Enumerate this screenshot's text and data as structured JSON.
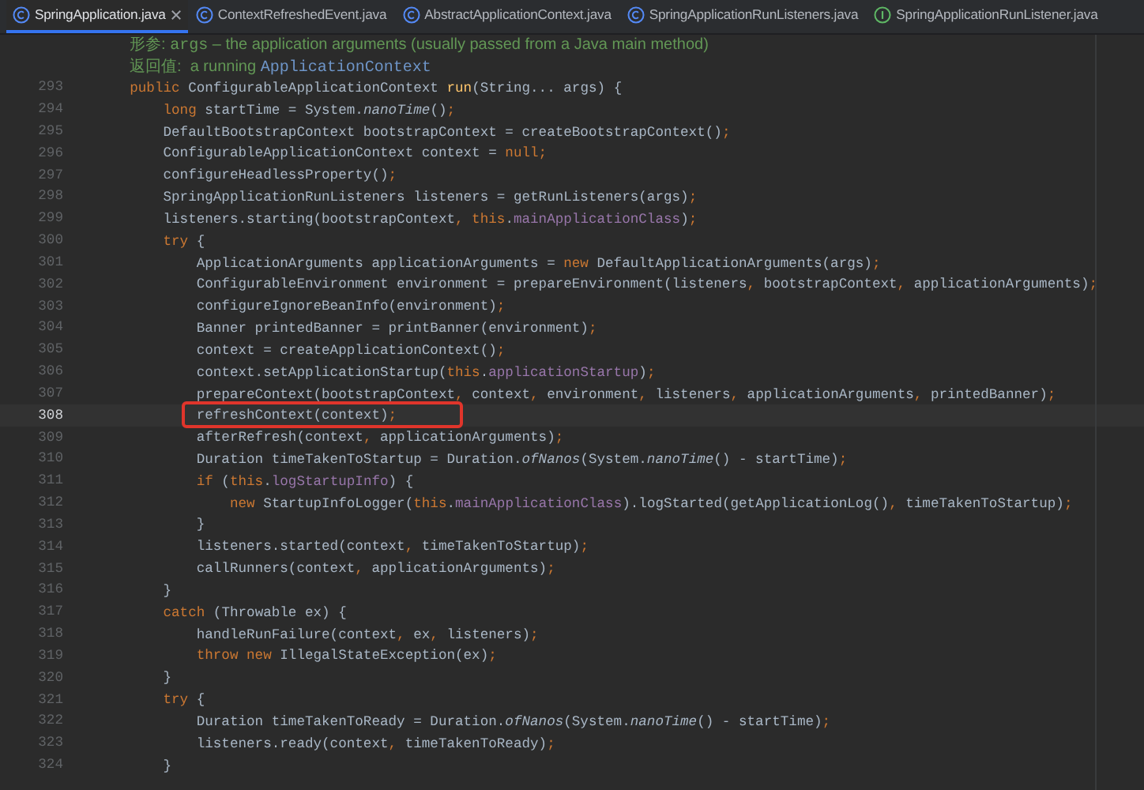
{
  "tabs": [
    {
      "label": "SpringApplication.java",
      "kind": "class",
      "selected": true
    },
    {
      "label": "ContextRefreshedEvent.java",
      "kind": "class",
      "selected": false
    },
    {
      "label": "AbstractApplicationContext.java",
      "kind": "class",
      "selected": false
    },
    {
      "label": "SpringApplicationRunListeners.java",
      "kind": "class",
      "selected": false
    },
    {
      "label": "SpringApplicationRunListener.java",
      "kind": "interface",
      "selected": false
    }
  ],
  "doc_lines": [
    {
      "label": "形参:",
      "parts": [
        {
          "kind": "code",
          "text": "args"
        },
        {
          "kind": "text",
          "text": " – the application arguments (usually passed from a Java main method)"
        }
      ]
    },
    {
      "label": "返回值:",
      "parts": [
        {
          "kind": "text",
          "text": " a running "
        },
        {
          "kind": "link",
          "text": "ApplicationContext"
        }
      ]
    }
  ],
  "lines": [
    {
      "number": "293",
      "current": false,
      "boxed": false,
      "segments": [
        {
          "kind": "keyword",
          "text": "    public"
        },
        {
          "kind": "plain",
          "text": " ConfigurableApplicationContext "
        },
        {
          "kind": "decl",
          "text": "run"
        },
        {
          "kind": "plain",
          "text": "(String... args) {"
        }
      ]
    },
    {
      "number": "294",
      "current": false,
      "boxed": false,
      "segments": [
        {
          "kind": "keyword",
          "text": "        long"
        },
        {
          "kind": "plain",
          "text": " startTime = System."
        },
        {
          "kind": "static",
          "text": "nanoTime"
        },
        {
          "kind": "plain",
          "text": "()"
        },
        {
          "kind": "keyword",
          "text": ";"
        }
      ]
    },
    {
      "number": "295",
      "current": false,
      "boxed": false,
      "segments": [
        {
          "kind": "plain",
          "text": "        DefaultBootstrapContext bootstrapContext = createBootstrapContext()"
        },
        {
          "kind": "keyword",
          "text": ";"
        }
      ]
    },
    {
      "number": "296",
      "current": false,
      "boxed": false,
      "segments": [
        {
          "kind": "plain",
          "text": "        ConfigurableApplicationContext context = "
        },
        {
          "kind": "keyword",
          "text": "null;"
        }
      ]
    },
    {
      "number": "297",
      "current": false,
      "boxed": false,
      "segments": [
        {
          "kind": "plain",
          "text": "        configureHeadlessProperty()"
        },
        {
          "kind": "keyword",
          "text": ";"
        }
      ]
    },
    {
      "number": "298",
      "current": false,
      "boxed": false,
      "segments": [
        {
          "kind": "plain",
          "text": "        SpringApplicationRunListeners listeners = getRunListeners(args)"
        },
        {
          "kind": "keyword",
          "text": ";"
        }
      ]
    },
    {
      "number": "299",
      "current": false,
      "boxed": false,
      "segments": [
        {
          "kind": "plain",
          "text": "        listeners.starting(bootstrapContext"
        },
        {
          "kind": "keyword",
          "text": ", this"
        },
        {
          "kind": "plain",
          "text": "."
        },
        {
          "kind": "field",
          "text": "mainApplicationClass"
        },
        {
          "kind": "plain",
          "text": ")"
        },
        {
          "kind": "keyword",
          "text": ";"
        }
      ]
    },
    {
      "number": "300",
      "current": false,
      "boxed": false,
      "segments": [
        {
          "kind": "keyword",
          "text": "        try"
        },
        {
          "kind": "plain",
          "text": " {"
        }
      ]
    },
    {
      "number": "301",
      "current": false,
      "boxed": false,
      "segments": [
        {
          "kind": "plain",
          "text": "            ApplicationArguments applicationArguments = "
        },
        {
          "kind": "keyword",
          "text": "new"
        },
        {
          "kind": "plain",
          "text": " DefaultApplicationArguments(args)"
        },
        {
          "kind": "keyword",
          "text": ";"
        }
      ]
    },
    {
      "number": "302",
      "current": false,
      "boxed": false,
      "segments": [
        {
          "kind": "plain",
          "text": "            ConfigurableEnvironment environment = prepareEnvironment(listeners"
        },
        {
          "kind": "keyword",
          "text": ", "
        },
        {
          "kind": "plain",
          "text": "bootstrapContext"
        },
        {
          "kind": "keyword",
          "text": ", "
        },
        {
          "kind": "plain",
          "text": "applicationArguments)"
        },
        {
          "kind": "keyword",
          "text": ";"
        }
      ]
    },
    {
      "number": "303",
      "current": false,
      "boxed": false,
      "segments": [
        {
          "kind": "plain",
          "text": "            configureIgnoreBeanInfo(environment)"
        },
        {
          "kind": "keyword",
          "text": ";"
        }
      ]
    },
    {
      "number": "304",
      "current": false,
      "boxed": false,
      "segments": [
        {
          "kind": "plain",
          "text": "            Banner printedBanner = printBanner(environment)"
        },
        {
          "kind": "keyword",
          "text": ";"
        }
      ]
    },
    {
      "number": "305",
      "current": false,
      "boxed": false,
      "segments": [
        {
          "kind": "plain",
          "text": "            context = createApplicationContext()"
        },
        {
          "kind": "keyword",
          "text": ";"
        }
      ]
    },
    {
      "number": "306",
      "current": false,
      "boxed": false,
      "segments": [
        {
          "kind": "plain",
          "text": "            context.setApplicationStartup("
        },
        {
          "kind": "keyword",
          "text": "this"
        },
        {
          "kind": "plain",
          "text": "."
        },
        {
          "kind": "field",
          "text": "applicationStartup"
        },
        {
          "kind": "plain",
          "text": ")"
        },
        {
          "kind": "keyword",
          "text": ";"
        }
      ]
    },
    {
      "number": "307",
      "current": false,
      "boxed": false,
      "segments": [
        {
          "kind": "plain",
          "text": "            prepareContext(bootstrapContext"
        },
        {
          "kind": "keyword",
          "text": ", "
        },
        {
          "kind": "plain",
          "text": "context"
        },
        {
          "kind": "keyword",
          "text": ", "
        },
        {
          "kind": "plain",
          "text": "environment"
        },
        {
          "kind": "keyword",
          "text": ", "
        },
        {
          "kind": "plain",
          "text": "listeners"
        },
        {
          "kind": "keyword",
          "text": ", "
        },
        {
          "kind": "plain",
          "text": "applicationArguments"
        },
        {
          "kind": "keyword",
          "text": ", "
        },
        {
          "kind": "plain",
          "text": "printedBanner)"
        },
        {
          "kind": "keyword",
          "text": ";"
        }
      ]
    },
    {
      "number": "308",
      "current": true,
      "boxed": true,
      "segments": [
        {
          "kind": "plain",
          "text": "            refreshContext(context)"
        },
        {
          "kind": "keyword",
          "text": ";"
        }
      ]
    },
    {
      "number": "309",
      "current": false,
      "boxed": false,
      "segments": [
        {
          "kind": "plain",
          "text": "            afterRefresh(context"
        },
        {
          "kind": "keyword",
          "text": ", "
        },
        {
          "kind": "plain",
          "text": "applicationArguments)"
        },
        {
          "kind": "keyword",
          "text": ";"
        }
      ]
    },
    {
      "number": "310",
      "current": false,
      "boxed": false,
      "segments": [
        {
          "kind": "plain",
          "text": "            Duration timeTakenToStartup = Duration."
        },
        {
          "kind": "static",
          "text": "ofNanos"
        },
        {
          "kind": "plain",
          "text": "(System."
        },
        {
          "kind": "static",
          "text": "nanoTime"
        },
        {
          "kind": "plain",
          "text": "() - startTime)"
        },
        {
          "kind": "keyword",
          "text": ";"
        }
      ]
    },
    {
      "number": "311",
      "current": false,
      "boxed": false,
      "segments": [
        {
          "kind": "keyword",
          "text": "            if"
        },
        {
          "kind": "plain",
          "text": " ("
        },
        {
          "kind": "keyword",
          "text": "this"
        },
        {
          "kind": "plain",
          "text": "."
        },
        {
          "kind": "field",
          "text": "logStartupInfo"
        },
        {
          "kind": "plain",
          "text": ") {"
        }
      ]
    },
    {
      "number": "312",
      "current": false,
      "boxed": false,
      "segments": [
        {
          "kind": "keyword",
          "text": "                new"
        },
        {
          "kind": "plain",
          "text": " StartupInfoLogger("
        },
        {
          "kind": "keyword",
          "text": "this"
        },
        {
          "kind": "plain",
          "text": "."
        },
        {
          "kind": "field",
          "text": "mainApplicationClass"
        },
        {
          "kind": "plain",
          "text": ").logStarted(getApplicationLog()"
        },
        {
          "kind": "keyword",
          "text": ", "
        },
        {
          "kind": "plain",
          "text": "timeTakenToStartup)"
        },
        {
          "kind": "keyword",
          "text": ";"
        }
      ]
    },
    {
      "number": "313",
      "current": false,
      "boxed": false,
      "segments": [
        {
          "kind": "plain",
          "text": "            }"
        }
      ]
    },
    {
      "number": "314",
      "current": false,
      "boxed": false,
      "segments": [
        {
          "kind": "plain",
          "text": "            listeners.started(context"
        },
        {
          "kind": "keyword",
          "text": ", "
        },
        {
          "kind": "plain",
          "text": "timeTakenToStartup)"
        },
        {
          "kind": "keyword",
          "text": ";"
        }
      ]
    },
    {
      "number": "315",
      "current": false,
      "boxed": false,
      "segments": [
        {
          "kind": "plain",
          "text": "            callRunners(context"
        },
        {
          "kind": "keyword",
          "text": ", "
        },
        {
          "kind": "plain",
          "text": "applicationArguments)"
        },
        {
          "kind": "keyword",
          "text": ";"
        }
      ]
    },
    {
      "number": "316",
      "current": false,
      "boxed": false,
      "segments": [
        {
          "kind": "plain",
          "text": "        }"
        }
      ]
    },
    {
      "number": "317",
      "current": false,
      "boxed": false,
      "segments": [
        {
          "kind": "keyword",
          "text": "        catch"
        },
        {
          "kind": "plain",
          "text": " (Throwable ex) {"
        }
      ]
    },
    {
      "number": "318",
      "current": false,
      "boxed": false,
      "segments": [
        {
          "kind": "plain",
          "text": "            handleRunFailure(context"
        },
        {
          "kind": "keyword",
          "text": ", "
        },
        {
          "kind": "plain",
          "text": "ex"
        },
        {
          "kind": "keyword",
          "text": ", "
        },
        {
          "kind": "plain",
          "text": "listeners)"
        },
        {
          "kind": "keyword",
          "text": ";"
        }
      ]
    },
    {
      "number": "319",
      "current": false,
      "boxed": false,
      "segments": [
        {
          "kind": "keyword",
          "text": "            throw new"
        },
        {
          "kind": "plain",
          "text": " IllegalStateException(ex)"
        },
        {
          "kind": "keyword",
          "text": ";"
        }
      ]
    },
    {
      "number": "320",
      "current": false,
      "boxed": false,
      "segments": [
        {
          "kind": "plain",
          "text": "        }"
        }
      ]
    },
    {
      "number": "321",
      "current": false,
      "boxed": false,
      "segments": [
        {
          "kind": "keyword",
          "text": "        try"
        },
        {
          "kind": "plain",
          "text": " {"
        }
      ]
    },
    {
      "number": "322",
      "current": false,
      "boxed": false,
      "segments": [
        {
          "kind": "plain",
          "text": "            Duration timeTakenToReady = Duration."
        },
        {
          "kind": "static",
          "text": "ofNanos"
        },
        {
          "kind": "plain",
          "text": "(System."
        },
        {
          "kind": "static",
          "text": "nanoTime"
        },
        {
          "kind": "plain",
          "text": "() - startTime)"
        },
        {
          "kind": "keyword",
          "text": ";"
        }
      ]
    },
    {
      "number": "323",
      "current": false,
      "boxed": false,
      "segments": [
        {
          "kind": "plain",
          "text": "            listeners.ready(context"
        },
        {
          "kind": "keyword",
          "text": ", "
        },
        {
          "kind": "plain",
          "text": "timeTakenToReady)"
        },
        {
          "kind": "keyword",
          "text": ";"
        }
      ]
    },
    {
      "number": "324",
      "current": false,
      "boxed": false,
      "segments": [
        {
          "kind": "plain",
          "text": "        }"
        }
      ]
    }
  ]
}
